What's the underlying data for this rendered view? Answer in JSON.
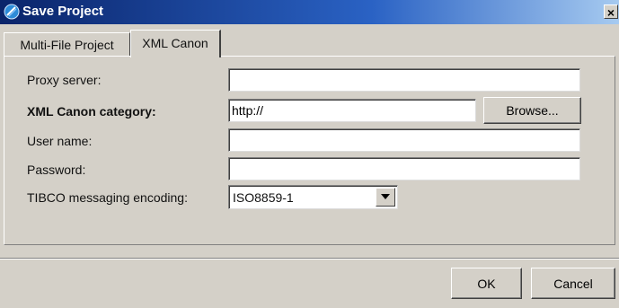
{
  "window": {
    "title": "Save Project",
    "close_label": "×"
  },
  "tabs": [
    {
      "label": "Multi-File Project",
      "active": false
    },
    {
      "label": "XML Canon",
      "active": true
    }
  ],
  "form": {
    "proxy_server": {
      "label": "Proxy server:",
      "value": ""
    },
    "category": {
      "label": "XML Canon category:",
      "value": "http://",
      "browse_label": "Browse..."
    },
    "user_name": {
      "label": "User name:",
      "value": ""
    },
    "password": {
      "label": "Password:",
      "value": ""
    },
    "encoding": {
      "label": "TIBCO messaging encoding:",
      "selected": "ISO8859-1"
    }
  },
  "footer": {
    "ok_label": "OK",
    "cancel_label": "Cancel"
  },
  "icons": {
    "title": "app-globe-icon",
    "close": "close-icon",
    "dropdown": "chevron-down-icon"
  },
  "colors": {
    "dialog_background": "#d4d0c8",
    "title_gradient_start": "#0a246a",
    "title_gradient_end": "#a6caf0"
  }
}
